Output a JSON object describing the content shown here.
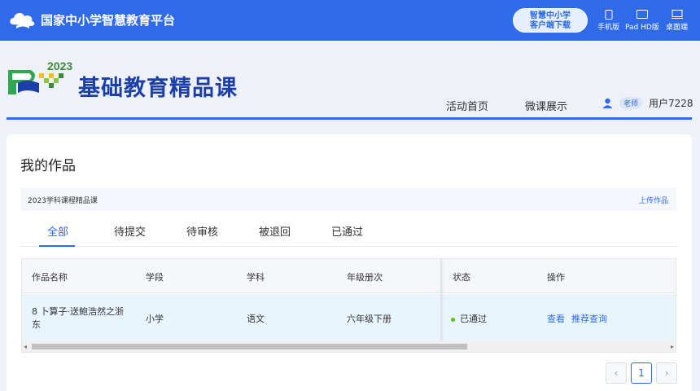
{
  "header": {
    "platform_name": "国家中小学智慧教育平台",
    "download_line1": "智慧中小学",
    "download_line2": "客户端下载",
    "devices": [
      {
        "label": "手机版",
        "icon": "phone-icon"
      },
      {
        "label": "Pad HD版",
        "icon": "tablet-icon"
      },
      {
        "label": "桌面端",
        "icon": "desktop-icon"
      }
    ],
    "bar_color": "#2f6be8"
  },
  "banner": {
    "logo_year": "2023",
    "title": "基础教育精品课",
    "nav": [
      "活动首页",
      "微课展示"
    ],
    "role_tag": "老师",
    "username": "用户7228"
  },
  "main": {
    "title": "我的作品",
    "category": "2023学科课程精品课",
    "upload_label": "上传作品",
    "tabs": [
      "全部",
      "待提交",
      "待审核",
      "被退回",
      "已通过"
    ],
    "active_tab": 0,
    "table": {
      "columns": [
        "作品名称",
        "学段",
        "学科",
        "年级册次",
        "状态",
        "操作"
      ],
      "rows": [
        {
          "name": "8 卜算子·送鲍浩然之浙东",
          "stage": "小学",
          "subject": "语文",
          "grade": "六年级下册",
          "status": "已通过",
          "actions": [
            "查看",
            "推荐查询"
          ]
        }
      ]
    },
    "pagination": {
      "prev": "‹",
      "current": "1",
      "next": "›"
    }
  },
  "colors": {
    "accent": "#2f6be8",
    "status_ok": "#52c41a",
    "row_highlight": "#e9f5fd"
  }
}
